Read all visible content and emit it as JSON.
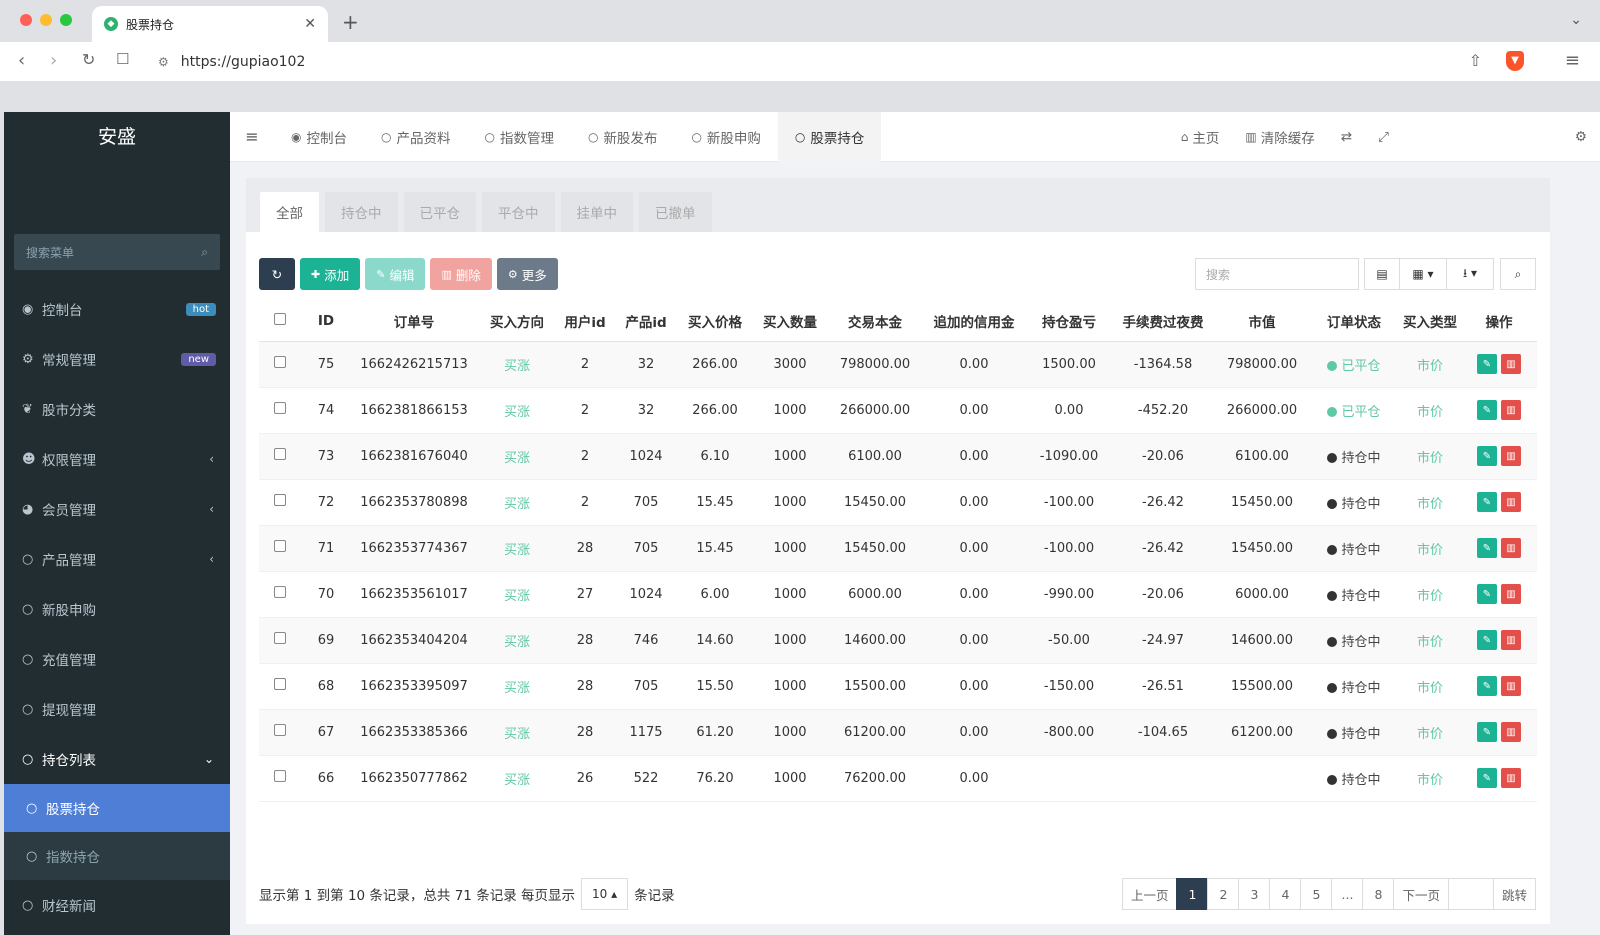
{
  "browser": {
    "tab_title": "股票持仓",
    "url": "https://gupiao102"
  },
  "sidebar": {
    "brand": "安盛",
    "search_placeholder": "搜索菜单",
    "items": [
      {
        "label": "控制台",
        "icon": "dashboard-icon",
        "badge": "hot",
        "badge_color": "#3c8dbc"
      },
      {
        "label": "常规管理",
        "icon": "cogs-icon",
        "badge": "new",
        "badge_color": "#605ca8"
      },
      {
        "label": "股市分类",
        "icon": "leaf-icon"
      },
      {
        "label": "权限管理",
        "icon": "group-icon",
        "arrow": "‹"
      },
      {
        "label": "会员管理",
        "icon": "user-circle-icon",
        "arrow": "‹"
      },
      {
        "label": "产品管理",
        "icon": "circle-icon",
        "arrow": "‹"
      },
      {
        "label": "新股申购",
        "icon": "circle-icon"
      },
      {
        "label": "充值管理",
        "icon": "circle-icon"
      },
      {
        "label": "提现管理",
        "icon": "circle-icon"
      },
      {
        "label": "持仓列表",
        "icon": "circle-icon",
        "arrow": "⌄"
      }
    ],
    "subitems": [
      {
        "label": "股票持仓"
      },
      {
        "label": "指数持仓"
      },
      {
        "label": "财经新闻"
      }
    ]
  },
  "topnav": {
    "tabs": [
      "控制台",
      "产品资料",
      "指数管理",
      "新股发布",
      "新股申购",
      "股票持仓"
    ],
    "home": "主页",
    "clear_cache": "清除缓存"
  },
  "panel": {
    "tabs": [
      "全部",
      "持仓中",
      "已平仓",
      "平仓中",
      "挂单中",
      "已撤单"
    ],
    "buttons": {
      "add": "添加",
      "edit": "编辑",
      "delete": "删除",
      "more": "更多"
    },
    "search_placeholder": "搜索"
  },
  "table": {
    "headers": [
      "ID",
      "订单号",
      "买入方向",
      "用户id",
      "产品id",
      "买入价格",
      "买入数量",
      "交易本金",
      "追加的信用金",
      "持仓盈亏",
      "手续费过夜费",
      "市值",
      "订单状态",
      "买入类型",
      "操作"
    ],
    "rows": [
      {
        "id": "75",
        "order": "1662426215713",
        "dir": "买涨",
        "uid": "2",
        "pid": "32",
        "price": "266.00",
        "qty": "3000",
        "principal": "798000.00",
        "credit": "0.00",
        "pnl": "1500.00",
        "fee": "-1364.58",
        "mv": "798000.00",
        "status": "已平仓",
        "closed": true,
        "type": "市价"
      },
      {
        "id": "74",
        "order": "1662381866153",
        "dir": "买涨",
        "uid": "2",
        "pid": "32",
        "price": "266.00",
        "qty": "1000",
        "principal": "266000.00",
        "credit": "0.00",
        "pnl": "0.00",
        "fee": "-452.20",
        "mv": "266000.00",
        "status": "已平仓",
        "closed": true,
        "type": "市价"
      },
      {
        "id": "73",
        "order": "1662381676040",
        "dir": "买涨",
        "uid": "2",
        "pid": "1024",
        "price": "6.10",
        "qty": "1000",
        "principal": "6100.00",
        "credit": "0.00",
        "pnl": "-1090.00",
        "fee": "-20.06",
        "mv": "6100.00",
        "status": "持仓中",
        "closed": false,
        "type": "市价"
      },
      {
        "id": "72",
        "order": "1662353780898",
        "dir": "买涨",
        "uid": "2",
        "pid": "705",
        "price": "15.45",
        "qty": "1000",
        "principal": "15450.00",
        "credit": "0.00",
        "pnl": "-100.00",
        "fee": "-26.42",
        "mv": "15450.00",
        "status": "持仓中",
        "closed": false,
        "type": "市价"
      },
      {
        "id": "71",
        "order": "1662353774367",
        "dir": "买涨",
        "uid": "28",
        "pid": "705",
        "price": "15.45",
        "qty": "1000",
        "principal": "15450.00",
        "credit": "0.00",
        "pnl": "-100.00",
        "fee": "-26.42",
        "mv": "15450.00",
        "status": "持仓中",
        "closed": false,
        "type": "市价"
      },
      {
        "id": "70",
        "order": "1662353561017",
        "dir": "买涨",
        "uid": "27",
        "pid": "1024",
        "price": "6.00",
        "qty": "1000",
        "principal": "6000.00",
        "credit": "0.00",
        "pnl": "-990.00",
        "fee": "-20.06",
        "mv": "6000.00",
        "status": "持仓中",
        "closed": false,
        "type": "市价"
      },
      {
        "id": "69",
        "order": "1662353404204",
        "dir": "买涨",
        "uid": "28",
        "pid": "746",
        "price": "14.60",
        "qty": "1000",
        "principal": "14600.00",
        "credit": "0.00",
        "pnl": "-50.00",
        "fee": "-24.97",
        "mv": "14600.00",
        "status": "持仓中",
        "closed": false,
        "type": "市价"
      },
      {
        "id": "68",
        "order": "1662353395097",
        "dir": "买涨",
        "uid": "28",
        "pid": "705",
        "price": "15.50",
        "qty": "1000",
        "principal": "15500.00",
        "credit": "0.00",
        "pnl": "-150.00",
        "fee": "-26.51",
        "mv": "15500.00",
        "status": "持仓中",
        "closed": false,
        "type": "市价"
      },
      {
        "id": "67",
        "order": "1662353385366",
        "dir": "买涨",
        "uid": "28",
        "pid": "1175",
        "price": "61.20",
        "qty": "1000",
        "principal": "61200.00",
        "credit": "0.00",
        "pnl": "-800.00",
        "fee": "-104.65",
        "mv": "61200.00",
        "status": "持仓中",
        "closed": false,
        "type": "市价"
      },
      {
        "id": "66",
        "order": "1662350777862",
        "dir": "买涨",
        "uid": "26",
        "pid": "522",
        "price": "76.20",
        "qty": "1000",
        "principal": "76200.00",
        "credit": "0.00",
        "pnl": "",
        "fee": "",
        "mv": "",
        "status": "持仓中",
        "closed": false,
        "type": "市价"
      }
    ]
  },
  "footer": {
    "summary": "显示第 1 到第 10 条记录，总共 71 条记录 每页显示",
    "page_size": "10",
    "suffix": "条记录"
  },
  "pager": {
    "prev": "上一页",
    "pages": [
      "1",
      "2",
      "3",
      "4",
      "5",
      "...",
      "8"
    ],
    "next": "下一页",
    "jump": "跳转"
  }
}
